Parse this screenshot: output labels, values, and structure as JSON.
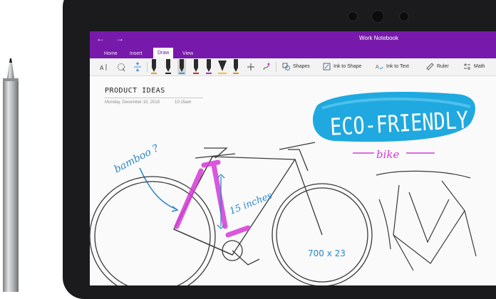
{
  "window": {
    "title": "Work Notebook",
    "back_glyph": "←",
    "forward_glyph": "→"
  },
  "ribbon": {
    "tabs": [
      "Home",
      "Insert",
      "Draw",
      "View"
    ],
    "active_tab": "Draw",
    "tools": {
      "shapes": "Shapes",
      "ink_to_shape": "Ink to Shape",
      "ink_to_text": "Ink to Text",
      "ruler": "Ruler",
      "math": "Math"
    }
  },
  "page": {
    "title": "PRODUCT IDEAS",
    "date": "Monday, December 10, 2018",
    "time": "10:15am"
  },
  "ink": {
    "headline": "ECO-FRIENDLY",
    "subhead": "bike",
    "annotation_material": "bamboo ?",
    "annotation_size": "15 inches",
    "annotation_wheel": "700 x 23"
  },
  "colors": {
    "accent": "#7719aa",
    "marker_cyan": "#1fa9e0",
    "ink_blue": "#2a86cc",
    "highlighter_magenta": "#d63ad8",
    "pencil": "#3a3a3a"
  }
}
